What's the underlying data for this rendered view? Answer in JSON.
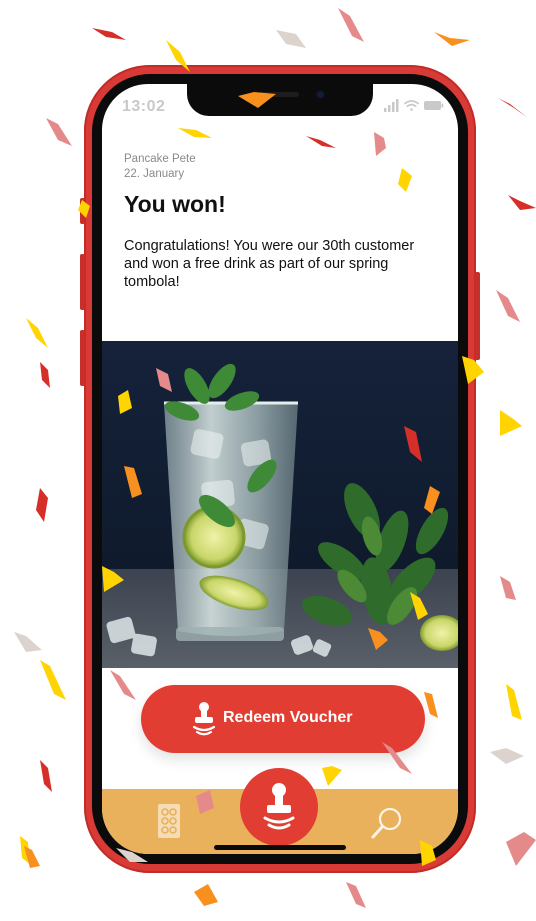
{
  "status_bar": {
    "time": "13:02",
    "icons": [
      "signal-icon",
      "wifi-icon",
      "battery-icon"
    ]
  },
  "voucher": {
    "merchant": "Pancake Pete",
    "date": "22. January",
    "title": "You won!",
    "message": "Congratulations! You were our 30th customer and won a free drink as part of our spring tombola!",
    "image": "mojito-glass-photo"
  },
  "redeem_button": {
    "label": "Redeem Voucher",
    "icon": "stamp-icon"
  },
  "bottom_nav": {
    "items": [
      {
        "icon": "stamp-card-icon"
      },
      {
        "icon": "stamp-icon",
        "active": true
      },
      {
        "icon": "search-icon"
      }
    ]
  },
  "colors": {
    "phone": "#d93a36",
    "accent": "#e23d33",
    "nav_background": "#e9b15b",
    "confetti": [
      "#ffd400",
      "#f7901e",
      "#d62f2a",
      "#e58a8a",
      "#dcd3ce"
    ]
  }
}
